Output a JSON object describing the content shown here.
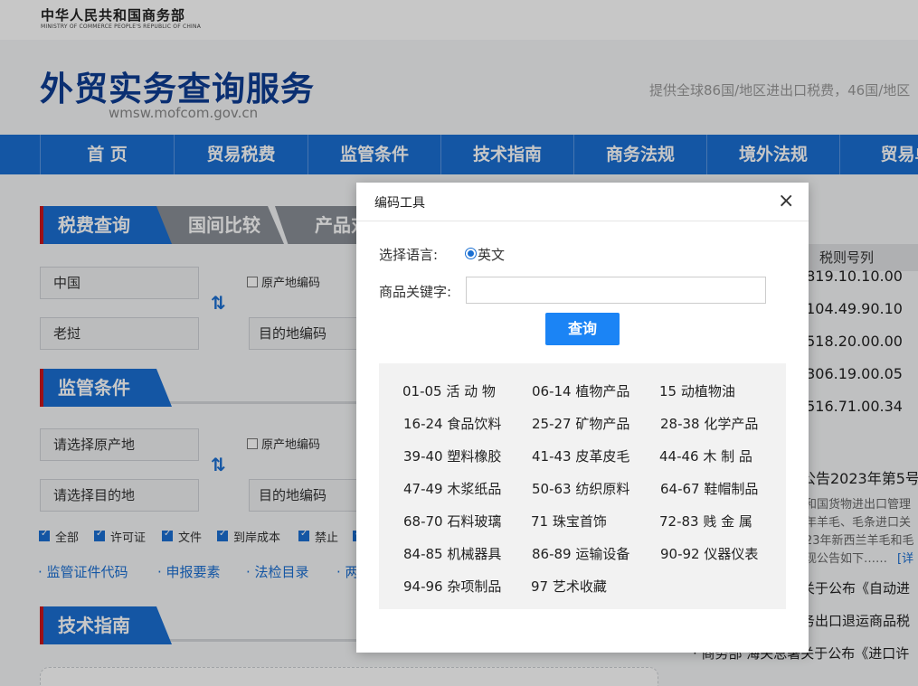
{
  "header": {
    "org_cn": "中华人民共和国商务部",
    "org_en": "MINISTRY OF COMMERCE PEOPLE'S REPUBLIC OF CHINA",
    "site_title": "外贸实务查询服务",
    "site_url": "wmsw.mofcom.gov.cn",
    "slogan": "提供全球86国/地区进出口税费，46国/地区"
  },
  "nav": {
    "items": [
      "首 页",
      "贸易税费",
      "监管条件",
      "技术指南",
      "商务法规",
      "境外法规",
      "贸易单"
    ],
    "active_index": 0
  },
  "tariff_section": {
    "tabs": [
      "税费查询",
      "国间比较",
      "产品对"
    ],
    "origin_value": "中国",
    "origin_code_label": "原产地编码",
    "dest_value": "老挝",
    "dest_code_placeholder": "目的地编码"
  },
  "regulation_section": {
    "title": "监管条件",
    "origin_placeholder": "请选择原产地",
    "origin_code_label": "原产地编码",
    "dest_placeholder": "请选择目的地",
    "dest_code_placeholder": "目的地编码",
    "checkboxes": [
      {
        "label": "全部",
        "checked": true
      },
      {
        "label": "许可证",
        "checked": true
      },
      {
        "label": "文件",
        "checked": true
      },
      {
        "label": "到岸成本",
        "checked": true
      },
      {
        "label": "禁止",
        "checked": true
      }
    ],
    "links": [
      "监管证件代码",
      "申报要素",
      "法检目录",
      "两"
    ]
  },
  "tech_section": {
    "title": "技术指南"
  },
  "right_panel": {
    "table_header": "税则号列",
    "codes": [
      ".819.10.10.00",
      ".104.49.90.10",
      ".518.20.00.00",
      ".306.19.00.05",
      ".516.71.00.34"
    ],
    "news": [
      {
        "title": "公告2023年第5号",
        "lines": [
          "和国货物进出口管理",
          "年羊毛、毛条进口关",
          "23年新西兰羊毛和毛",
          "现公告如下……"
        ],
        "detail_link": "[详"
      },
      {
        "title": "关于公布《自动进"
      },
      {
        "title": "务出口退运商品税"
      },
      {
        "title": "· 商务部 海关总署关于公布《进口许"
      }
    ]
  },
  "modal": {
    "title": "编码工具",
    "close_glyph": "×",
    "language_label": "选择语言:",
    "language_option": "英文",
    "keyword_label": "商品关键字:",
    "keyword_value": "",
    "search_button": "查询",
    "categories": [
      [
        "01-05 活  动  物",
        "06-14 植物产品",
        "15        动植物油"
      ],
      [
        "16-24 食品饮料",
        "25-27 矿物产品",
        "28-38 化学产品"
      ],
      [
        "39-40 塑料橡胶",
        "41-43 皮革皮毛",
        "44-46 木  制  品"
      ],
      [
        "47-49 木浆纸品",
        "50-63 纺织原料",
        "64-67 鞋帽制品"
      ],
      [
        "68-70 石料玻璃",
        "71        珠宝首饰",
        "72-83 贱  金  属"
      ],
      [
        "84-85 机械器具",
        "86-89 运输设备",
        "90-92 仪器仪表"
      ],
      [
        "94-96 杂项制品",
        "97        艺术收藏"
      ]
    ]
  }
}
